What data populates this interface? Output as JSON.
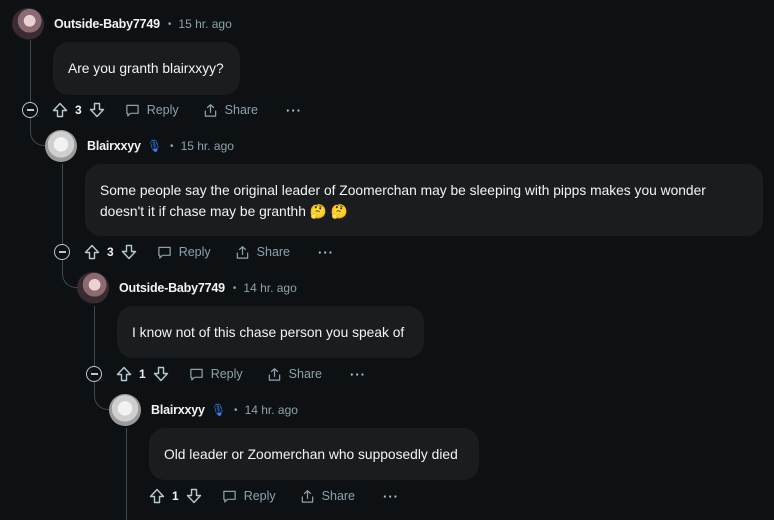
{
  "comments": [
    {
      "username": "Outside-Baby7749",
      "time": "15 hr. ago",
      "text": "Are you granth blairxxyy?",
      "score": "3",
      "reply_label": "Reply",
      "share_label": "Share",
      "more_label": "···"
    },
    {
      "username": "Blairxxyy",
      "time": "15 hr. ago",
      "text": "Some people say the original leader of Zoomerchan may be sleeping with pipps makes you wonder doesn't it if chase may be granthh 🤔 🤔",
      "score": "3",
      "reply_label": "Reply",
      "share_label": "Share",
      "more_label": "···"
    },
    {
      "username": "Outside-Baby7749",
      "time": "14 hr. ago",
      "text": "I know not of this chase person you speak of",
      "score": "1",
      "reply_label": "Reply",
      "share_label": "Share",
      "more_label": "···"
    },
    {
      "username": "Blairxxyy",
      "time": "14 hr. ago",
      "text": "Old leader or Zoomerchan who supposedly died",
      "score": "1",
      "reply_label": "Reply",
      "share_label": "Share",
      "more_label": "···"
    }
  ],
  "separator": "•",
  "colors": {
    "background": "#0e1113",
    "bubble": "#1a1d20",
    "mic_badge": "#3b82f6"
  }
}
